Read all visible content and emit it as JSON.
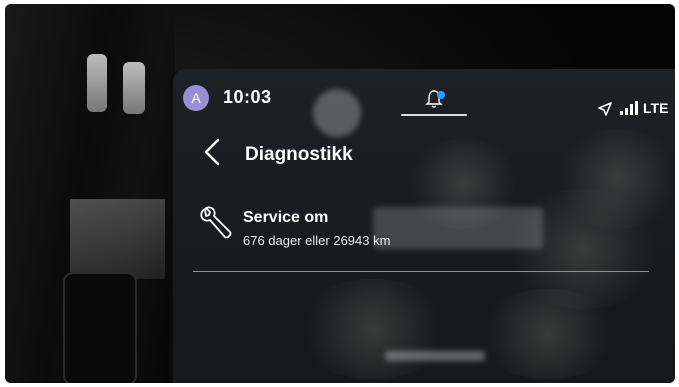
{
  "status_bar": {
    "avatar_letter": "A",
    "time": "10:03",
    "network": "LTE",
    "notification_dot_color": "#2e9bff"
  },
  "header": {
    "title": "Diagnostikk"
  },
  "service_row": {
    "title": "Service om",
    "detail": "676 dager eller 26943 km"
  },
  "icons": [
    "avatar-icon",
    "bell-icon",
    "navigation-arrow-icon",
    "signal-bars-icon",
    "back-chevron-icon",
    "wrench-icon"
  ]
}
